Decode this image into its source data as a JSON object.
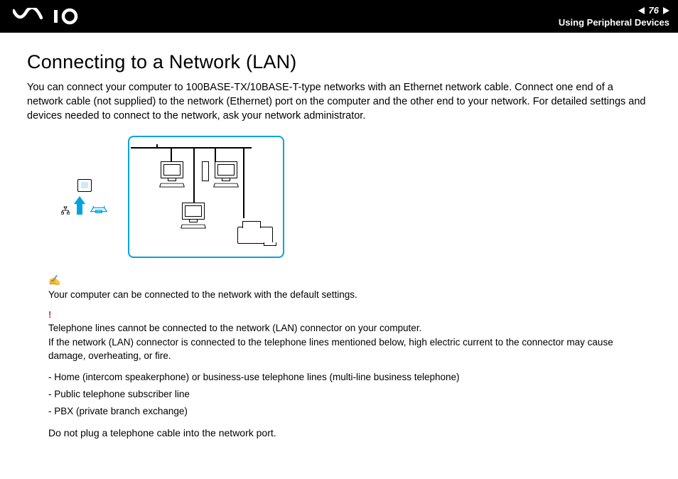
{
  "header": {
    "page_number": "76",
    "section": "Using Peripheral Devices"
  },
  "title": "Connecting to a Network (LAN)",
  "intro": "You can connect your computer to 100BASE-TX/10BASE-T-type networks with an Ethernet network cable. Connect one end of a network cable (not supplied) to the network (Ethernet) port on the computer and the other end to your network. For detailed settings and devices needed to connect to the network, ask your network administrator.",
  "tip_text": "Your computer can be connected to the network with the default settings.",
  "warning_line1": "Telephone lines cannot be connected to the network (LAN) connector on your computer.",
  "warning_line2": "If the network (LAN) connector is connected to the telephone lines mentioned below, high electric current to the connector may cause damage, overheating, or fire.",
  "bullets": [
    "- Home (intercom speakerphone) or business-use telephone lines (multi-line business telephone)",
    "- Public telephone subscriber line",
    "- PBX (private branch exchange)"
  ],
  "final_line": "Do not plug a telephone cable into the network port."
}
